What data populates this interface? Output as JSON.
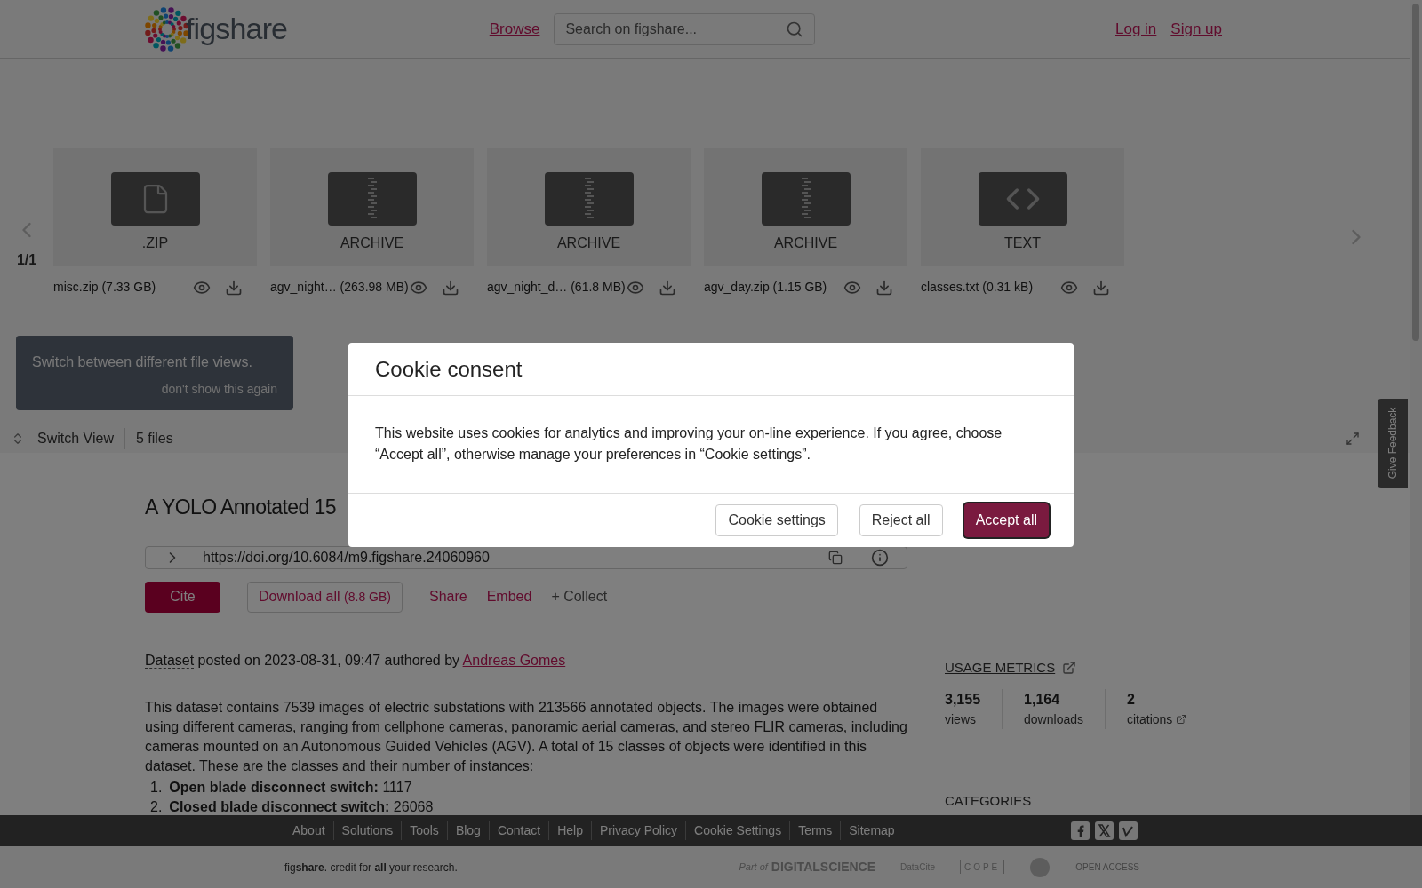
{
  "header": {
    "logo": "figshare",
    "nav_link": "Browse",
    "search": {
      "placeholder": "Search on figshare..."
    },
    "auth_links": [
      "Log in",
      "Sign up"
    ]
  },
  "file_carousel": {
    "page": "1/1",
    "files": [
      {
        "kind": "file",
        "type_label": ".ZIP",
        "name": "misc.zip",
        "size": "(7.33 GB)"
      },
      {
        "kind": "archive",
        "type_label": "ARCHIVE",
        "name": "agv_night…",
        "size": "(263.98 MB)"
      },
      {
        "kind": "archive",
        "type_label": "ARCHIVE",
        "name": "agv_night_d…",
        "size": "(61.8 MB)"
      },
      {
        "kind": "archive",
        "type_label": "ARCHIVE",
        "name": "agv_day.zip",
        "size": "(1.15 GB)"
      },
      {
        "kind": "code",
        "type_label": "TEXT",
        "name": "classes.txt",
        "size": "(0.31 kB)"
      }
    ]
  },
  "tooltip": {
    "text": "Switch between different file views.",
    "dismiss": "don't show this again"
  },
  "view_bar": {
    "switch_view": "Switch View",
    "file_count": "5 files"
  },
  "feedback_tab": "Give Feedback",
  "item": {
    "title": "A YOLO Annotated 15",
    "doi": "https://doi.org/10.6084/m9.figshare.24060960",
    "actions": {
      "cite": "Cite",
      "download": "Download all",
      "download_size": "(8.8 GB)",
      "share": "Share",
      "embed": "Embed",
      "collect": "+ Collect"
    },
    "meta": {
      "type": "Dataset",
      "posted": "posted on 2023-08-31, 09:47 authored by",
      "author": "Andreas Gomes"
    },
    "description": "This dataset contains 7539 images of electric substations with 213566 annotated objects. The images were obtained using different cameras, ranging from cellphone cameras, panoramic aerial cameras, and stereo FLIR cameras, including cameras mounted on an Autonomous Guided Vehicles (AGV). A total of 15 classes of objects were identified in this dataset. These are the classes and their number of instances:",
    "classes": [
      {
        "marker": "1.",
        "text": "**Open blade disconnect switch:** 1117"
      },
      {
        "marker": "2.",
        "text": "**Closed blade disconnect switch:** 26068"
      }
    ]
  },
  "metrics": {
    "title": "USAGE METRICS",
    "stats": [
      {
        "value": "3,155",
        "label": "views",
        "link": false
      },
      {
        "value": "1,164",
        "label": "downloads",
        "link": false
      },
      {
        "value": "2",
        "label": "citations",
        "link": true
      }
    ]
  },
  "categories": {
    "title": "CATEGORIES"
  },
  "footer": {
    "links": [
      "About",
      "Solutions",
      "Tools",
      "Blog",
      "Contact",
      "Help",
      "Privacy Policy",
      "Cookie Settings",
      "Terms",
      "Sitemap"
    ],
    "tagline": "fig**share**. credit for **all** your research.",
    "partners": [
      "Part of",
      "DIGITALSCIENCE",
      "DataCite",
      "COPE",
      "OPEN ACCESS"
    ]
  },
  "cookie_modal": {
    "title": "Cookie consent",
    "body": "This website uses cookies for analytics and improving your on-line experience. If you agree, choose “Accept all”, otherwise manage your preferences in “Cookie settings”.",
    "buttons": [
      {
        "label": "Cookie settings",
        "primary": false
      },
      {
        "label": "Reject all",
        "primary": false
      },
      {
        "label": "Accept all",
        "primary": true
      }
    ]
  }
}
